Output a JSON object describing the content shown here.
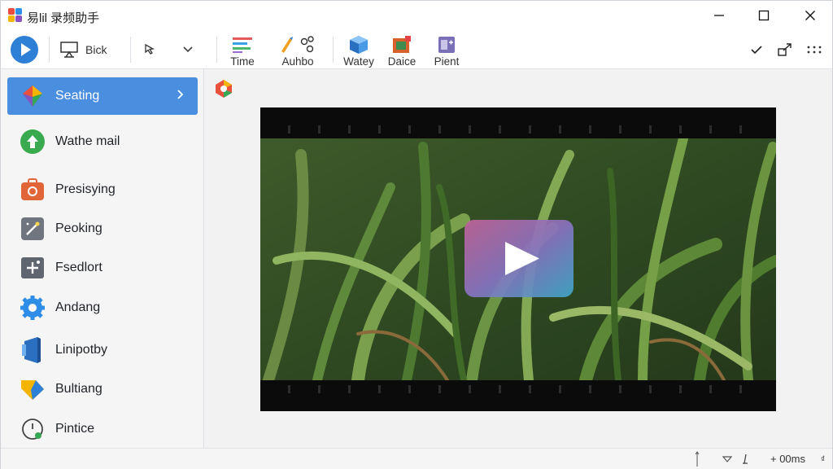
{
  "app": {
    "title": "易lil 录频助手"
  },
  "window_controls": {
    "minimize": "minimize-icon",
    "maximize": "maximize-icon",
    "close": "close-icon"
  },
  "toolbar": {
    "bick_label": "Bick",
    "stack_items": [
      {
        "label": "Time",
        "icon": "timeline-icon"
      },
      {
        "label": "Auhbo",
        "icon": "audio-pen-icon"
      },
      {
        "label": "Watey",
        "icon": "water-cube-icon"
      },
      {
        "label": "Daice",
        "icon": "device-box-icon"
      },
      {
        "label": "Pient",
        "icon": "print-icon"
      }
    ]
  },
  "sidebar": {
    "items": [
      {
        "label": "Seating",
        "active": true
      },
      {
        "label": "Wathe mail"
      },
      {
        "label": "Presisying"
      },
      {
        "label": "Peoking"
      },
      {
        "label": "Fsedlort"
      },
      {
        "label": "Andang"
      },
      {
        "label": "Linipotby"
      },
      {
        "label": "Bultiang"
      },
      {
        "label": "Pintice"
      }
    ]
  },
  "statusbar": {
    "time": "+ 00ms",
    "corner": "₫"
  },
  "colors": {
    "accent": "#4a8ee0",
    "play_button_left": "#c2639a",
    "play_button_right": "#3fa7c9"
  }
}
